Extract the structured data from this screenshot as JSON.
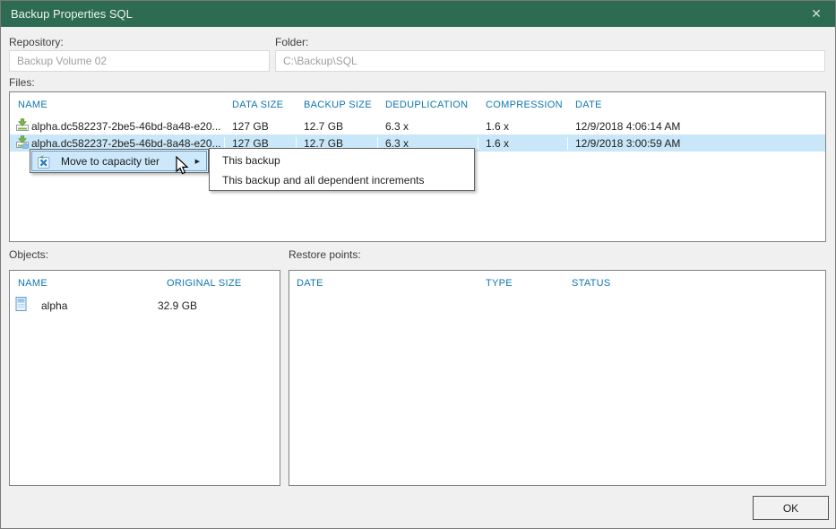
{
  "window": {
    "title": "Backup Properties SQL"
  },
  "icons": {
    "close": "✕",
    "submenu_arrow": "▶"
  },
  "colors": {
    "titlebar": "#2d6b52",
    "header_text": "#0e76b1",
    "selection": "#c9e7f8"
  },
  "form": {
    "repository_label": "Repository:",
    "repository_value": "Backup Volume 02",
    "folder_label": "Folder:",
    "folder_value": "C:\\Backup\\SQL"
  },
  "files": {
    "label": "Files:",
    "columns": [
      "NAME",
      "DATA SIZE",
      "BACKUP SIZE",
      "DEDUPLICATION",
      "COMPRESSION",
      "DATE"
    ],
    "rows": [
      {
        "name": "alpha.dc582237-2be5-46bd-8a48-e20...",
        "data_size": "127 GB",
        "backup_size": "12.7 GB",
        "deduplication": "6.3 x",
        "compression": "1.6 x",
        "date": "12/9/2018 4:06:14 AM"
      },
      {
        "name": "alpha.dc582237-2be5-46bd-8a48-e20...",
        "data_size": "127 GB",
        "backup_size": "12.7 GB",
        "deduplication": "6.3 x",
        "compression": "1.6 x",
        "date": "12/9/2018 3:00:59 AM"
      }
    ]
  },
  "context_menu": {
    "label": "Move to capacity tier",
    "items": [
      "This backup",
      "This backup and all dependent increments"
    ]
  },
  "objects": {
    "label": "Objects:",
    "columns": [
      "NAME",
      "ORIGINAL SIZE"
    ],
    "rows": [
      {
        "name": "alpha",
        "original_size": "32.9 GB"
      }
    ]
  },
  "restore_points": {
    "label": "Restore points:",
    "columns": [
      "DATE",
      "TYPE",
      "STATUS"
    ]
  },
  "footer": {
    "ok": "OK"
  }
}
